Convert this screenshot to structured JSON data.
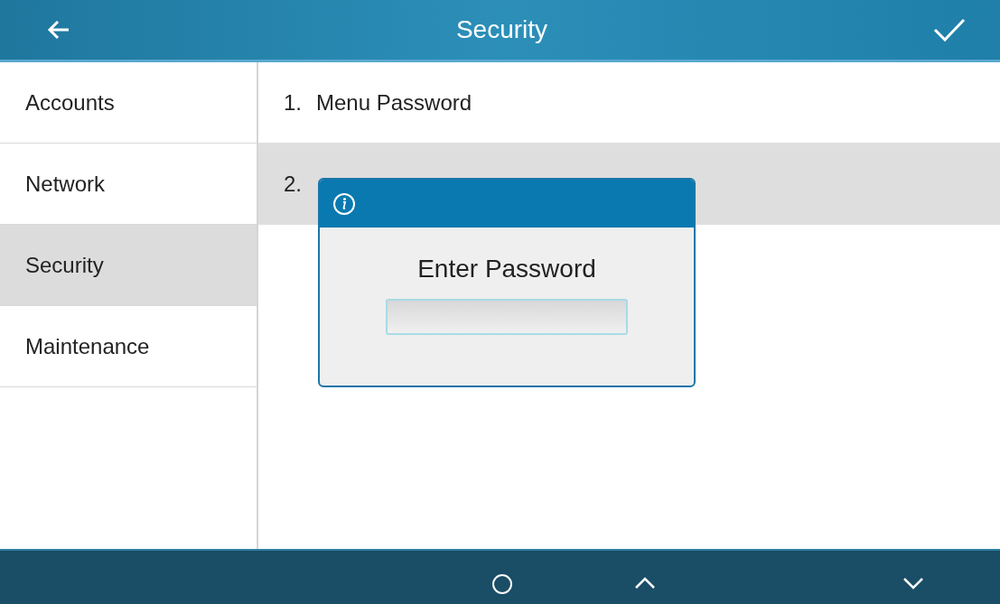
{
  "header": {
    "title": "Security"
  },
  "sidebar": {
    "items": [
      {
        "label": "Accounts",
        "selected": false
      },
      {
        "label": "Network",
        "selected": false
      },
      {
        "label": "Security",
        "selected": true
      },
      {
        "label": "Maintenance",
        "selected": false
      }
    ]
  },
  "menu": {
    "items": [
      {
        "number": "1.",
        "label": "Menu Password",
        "selected": false
      },
      {
        "number": "2.",
        "selected": true
      }
    ]
  },
  "dialog": {
    "message": "Enter Password"
  },
  "softkeys": [
    {
      "kind": "circle"
    },
    {
      "kind": "up"
    },
    {
      "kind": "down"
    }
  ]
}
